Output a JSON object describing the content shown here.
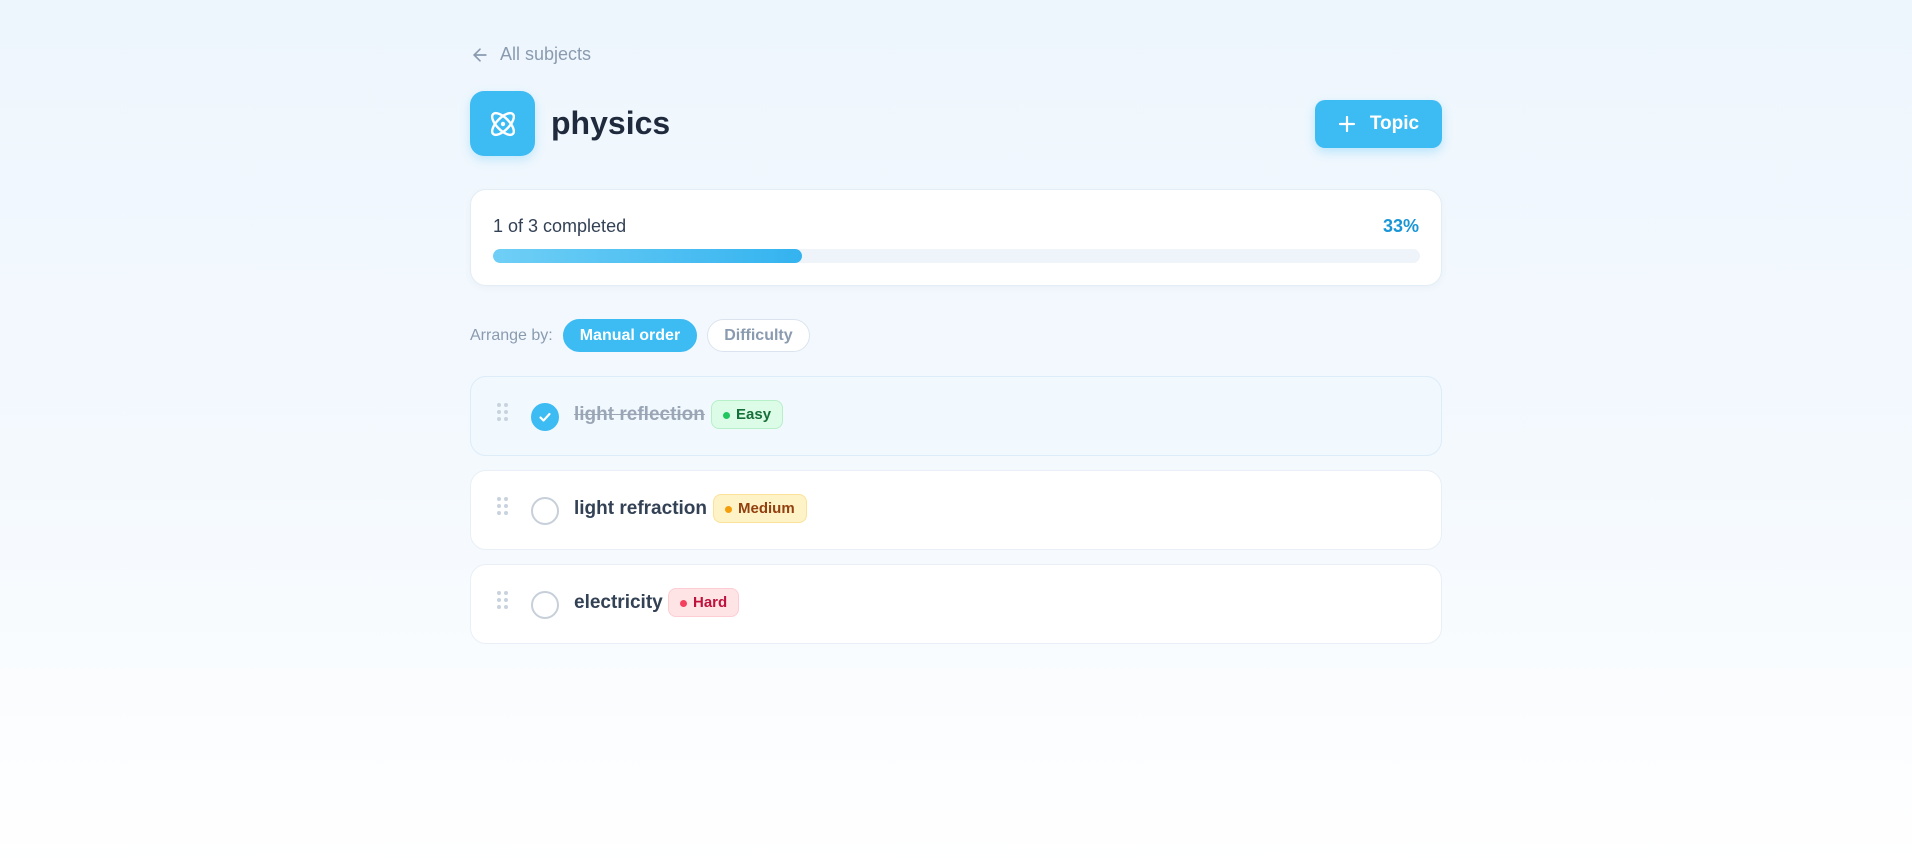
{
  "nav": {
    "back_label": "All subjects"
  },
  "subject": {
    "title": "physics",
    "icon": "atom-icon",
    "accent": "#3dbbf3"
  },
  "actions": {
    "add_topic_label": "Topic"
  },
  "progress": {
    "summary": "1 of 3 completed",
    "percent_label": "33%",
    "completed": 1,
    "total": 3,
    "fraction": 0.333
  },
  "arrange": {
    "label": "Arrange by:",
    "options": [
      {
        "label": "Manual order",
        "active": true
      },
      {
        "label": "Difficulty",
        "active": false
      }
    ]
  },
  "topics": [
    {
      "name": "light reflection",
      "difficulty": "Easy",
      "completed": true,
      "color": "#22c55e"
    },
    {
      "name": "light refraction",
      "difficulty": "Medium",
      "completed": false,
      "color": "#f59e0b"
    },
    {
      "name": "electricity",
      "difficulty": "Hard",
      "completed": false,
      "color": "#f43f5e"
    }
  ]
}
